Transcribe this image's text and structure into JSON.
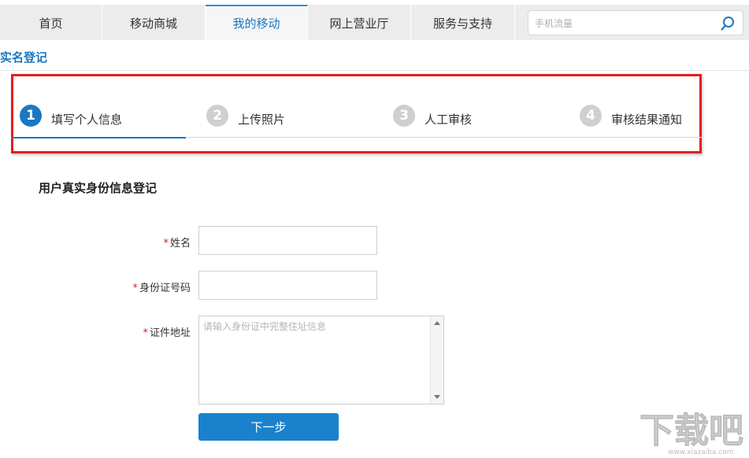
{
  "nav": {
    "items": [
      {
        "label": "首页"
      },
      {
        "label": "移动商城"
      },
      {
        "label": "我的移动"
      },
      {
        "label": "网上营业厅"
      },
      {
        "label": "服务与支持"
      }
    ],
    "active_index": 2,
    "search_placeholder": "手机流量"
  },
  "page": {
    "title": "实名登记"
  },
  "steps": [
    {
      "number": "1",
      "label": "填写个人信息",
      "active": true
    },
    {
      "number": "2",
      "label": "上传照片",
      "active": false
    },
    {
      "number": "3",
      "label": "人工审核",
      "active": false
    },
    {
      "number": "4",
      "label": "审核结果通知",
      "active": false
    }
  ],
  "form": {
    "section_title": "用户真实身份信息登记",
    "required_mark": "*",
    "name_label": "姓名",
    "id_label": "身份证号码",
    "address_label": "证件地址",
    "address_placeholder": "请输入身份证中完整住址信息",
    "next_label": "下一步"
  },
  "watermark": {
    "text": "下载吧",
    "subtext": "www.xiazaiba.com"
  },
  "colors": {
    "accent": "#1a78c2",
    "highlight_frame": "#e02020",
    "required": "#e02020"
  }
}
